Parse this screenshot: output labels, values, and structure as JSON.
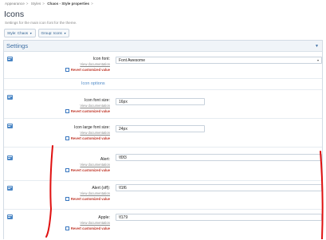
{
  "breadcrumb": [
    "Appearance",
    "Styles",
    "Chaos - Style properties"
  ],
  "page": {
    "title": "Icons",
    "description": "Settings for the main icon font for the theme."
  },
  "selectors": {
    "style": "Style: Chaos",
    "group": "Group: Icons"
  },
  "panel": {
    "title": "Settings"
  },
  "common": {
    "view_doc": "View documentation",
    "revert": "Revert customized value"
  },
  "properties": {
    "icon_font": {
      "label": "Icon font:",
      "value": "Font Awesome"
    },
    "section": "Icon options",
    "icon_font_size": {
      "label": "Icon font size:",
      "value": "16px"
    },
    "icon_large_font_size": {
      "label": "Icon large font size:",
      "value": "24px"
    },
    "alert": {
      "label": "Alert:",
      "value": "\\f0f3"
    },
    "alert_off": {
      "label": "Alert (off):",
      "value": "\\f1f6"
    },
    "apple": {
      "label": "Apple:",
      "value": "\\f179"
    }
  },
  "colors": {
    "accent": "#3e6fa4",
    "revert": "#c0392b",
    "annotation": "#e01010"
  },
  "icons": {
    "property": "list-icon",
    "collapse": "caret-down-icon"
  }
}
